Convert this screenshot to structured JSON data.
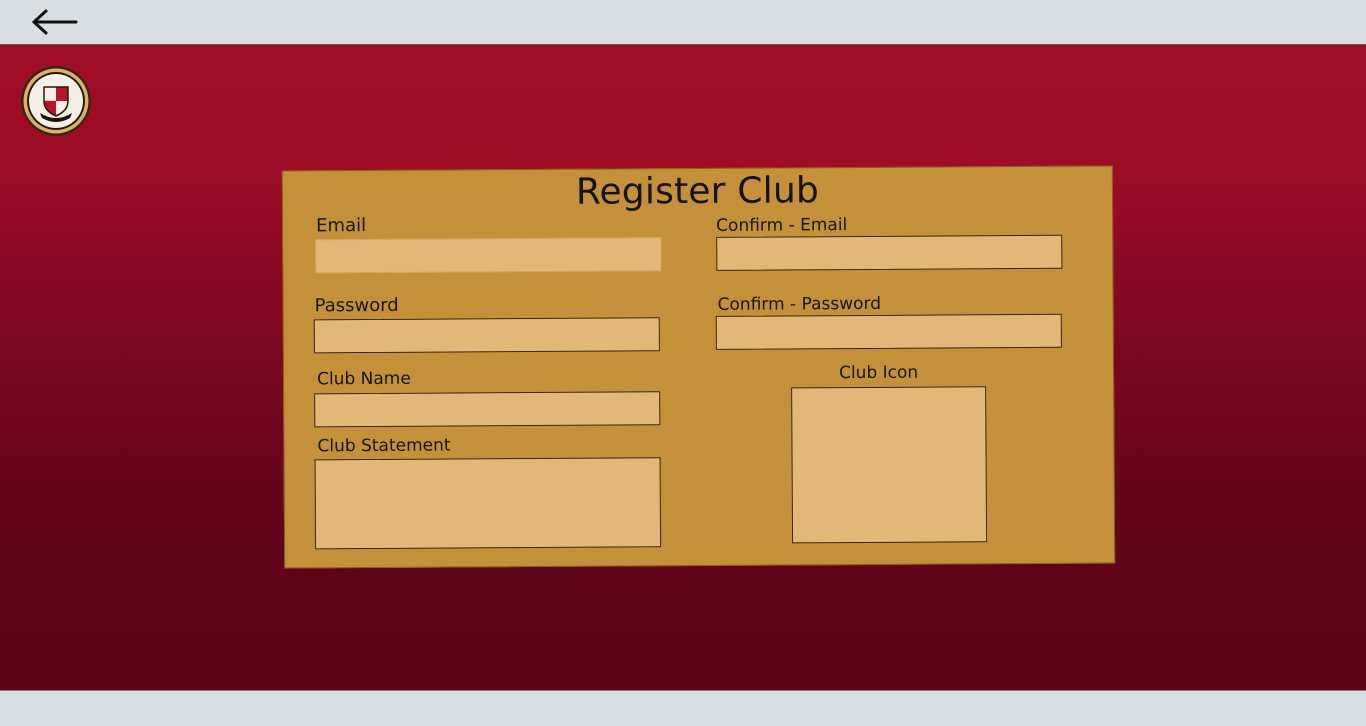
{
  "nav": {
    "back_icon": "arrow-left-icon"
  },
  "logo": {
    "icon": "club-crest-icon"
  },
  "form": {
    "title": "Register Club",
    "email_label": "Email",
    "confirm_email_label": "Confirm - Email",
    "password_label": "Password",
    "confirm_password_label": "Confirm - Password",
    "club_name_label": "Club Name",
    "club_icon_label": "Club Icon",
    "club_statement_label": "Club Statement",
    "email_value": "",
    "confirm_email_value": "",
    "password_value": "",
    "confirm_password_value": "",
    "club_name_value": "",
    "club_statement_value": ""
  },
  "colors": {
    "background_top": "#a10d27",
    "background_bottom": "#5d0419",
    "card": "#c4903a",
    "field": "#e3b877",
    "bar": "#d8dde1"
  }
}
